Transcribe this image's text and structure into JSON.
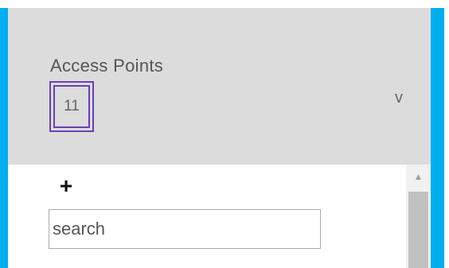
{
  "panel": {
    "title": "Access Points",
    "count": "11",
    "chevron_glyph": "v",
    "chevron_icon": "chevron-down-icon"
  },
  "list": {
    "add_glyph": "+",
    "add_icon": "plus-icon",
    "search_placeholder": "search",
    "search_value": ""
  },
  "colors": {
    "accent_border": "#00adef",
    "header_bg": "#dcdcdc",
    "badge_outline": "#6a3fb5"
  }
}
